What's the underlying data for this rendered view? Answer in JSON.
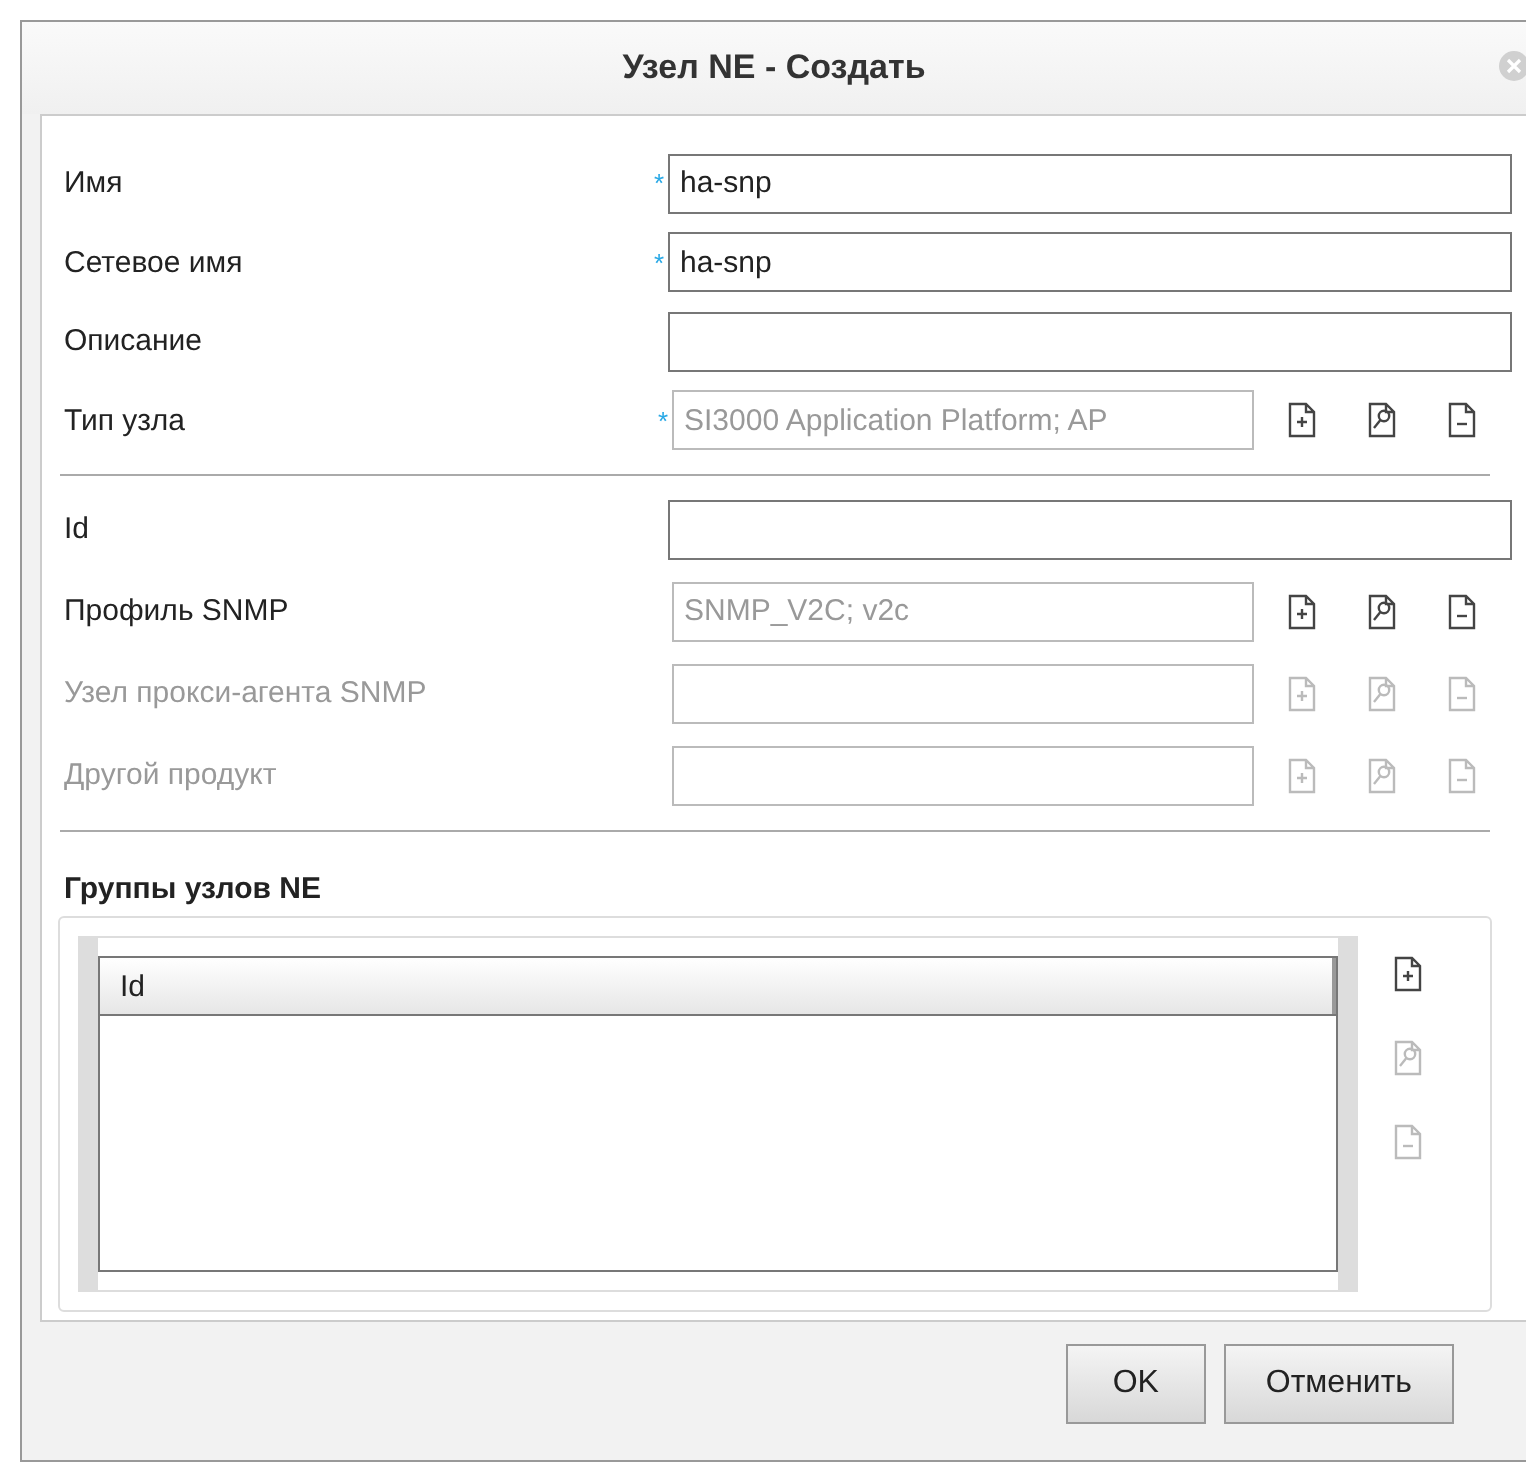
{
  "dialog": {
    "title": "Узел NE - Создать"
  },
  "sections": [
    {
      "fields": [
        {
          "label": "Имя",
          "kind": "text",
          "required_mark": "*",
          "value": "ha-snp"
        },
        {
          "label": "Сетевое имя",
          "kind": "text",
          "required_mark": "*",
          "value": "ha-snp"
        },
        {
          "label": "Описание",
          "kind": "text"
        },
        {
          "label": "Тип узла",
          "kind": "lookup",
          "required_mark": "*",
          "disabled": false,
          "value": "SI3000 Application Platform; AP"
        }
      ]
    },
    {
      "fields": [
        {
          "label": "Id",
          "kind": "text"
        },
        {
          "label": "Профиль SNMP",
          "kind": "lookup",
          "disabled": false,
          "value": "SNMP_V2C; v2c"
        },
        {
          "label": "Узел прокси-агента SNMP",
          "kind": "lookup",
          "disabled": true
        },
        {
          "label": "Другой продукт",
          "kind": "lookup",
          "disabled": true
        }
      ]
    }
  ],
  "groups": {
    "title": "Группы узлов NE",
    "columns": [
      "Id"
    ],
    "actions": [
      {
        "kind": "add",
        "disabled": false
      },
      {
        "kind": "view",
        "disabled": true
      },
      {
        "kind": "remove",
        "disabled": true
      }
    ]
  },
  "buttons": [
    "OK",
    "Отменить"
  ]
}
